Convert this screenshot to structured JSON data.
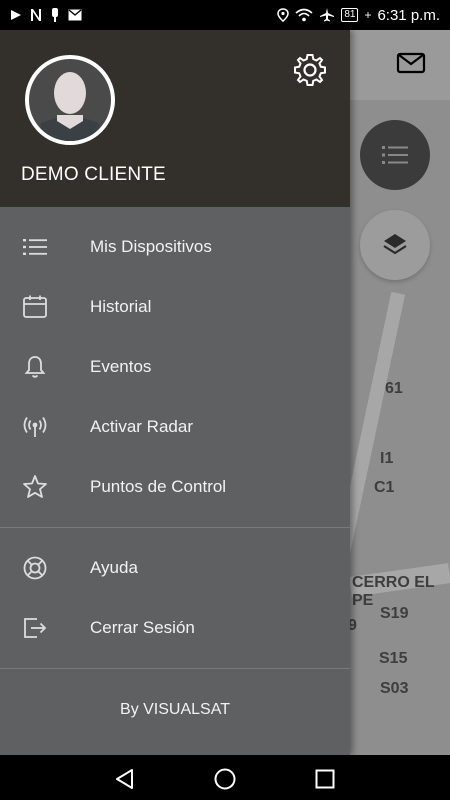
{
  "status_bar": {
    "time": "6:31 p.m.",
    "battery": "81",
    "left_icons": [
      "play-icon",
      "n-icon",
      "usb-icon",
      "gmail-icon"
    ],
    "right_icons": [
      "location-icon",
      "wifi-icon",
      "airplane-icon",
      "battery-icon"
    ]
  },
  "drawer": {
    "user_name": "DEMO CLIENTE",
    "menu_items": [
      {
        "label": "Mis Dispositivos",
        "icon": "list-icon"
      },
      {
        "label": "Historial",
        "icon": "calendar-icon"
      },
      {
        "label": "Eventos",
        "icon": "bell-icon"
      },
      {
        "label": "Activar Radar",
        "icon": "radar-icon"
      },
      {
        "label": "Puntos de Control",
        "icon": "star-icon"
      }
    ],
    "secondary_items": [
      {
        "label": "Ayuda",
        "icon": "lifebuoy-icon"
      },
      {
        "label": "Cerrar Sesión",
        "icon": "logout-icon"
      }
    ],
    "footer": "By VISUALSAT"
  },
  "map": {
    "labels": [
      "61",
      "I1",
      "C1",
      "CERRO EL PE",
      "S19",
      "9",
      "S15",
      "S03"
    ]
  },
  "colors": {
    "header_bg": "#33302b",
    "drawer_bg": "#5e6061",
    "map_bg": "#8e8e8e"
  }
}
